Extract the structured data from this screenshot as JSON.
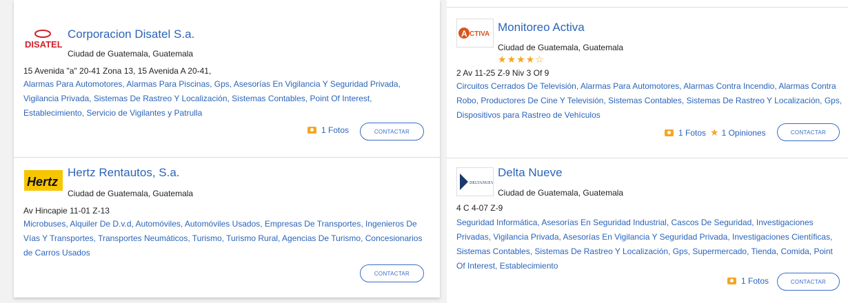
{
  "listings": [
    {
      "name": "Corporacion Disatel S.a.",
      "city": "Ciudad de Guatemala, Guatemala",
      "address": "15 Avenida \"a\" 20-41 Zona 13, 15 Avenida A 20-41,",
      "categories": "Alarmas Para Automotores, Alarmas Para Piscinas, Gps, Asesorías En Vigilancia Y Seguridad Privada, Vigilancia Privada, Sistemas De Rastreo Y Localización, Sistemas Contables, Point Of Interest, Establecimiento, Servicio de Vigilantes y Patrulla",
      "photos": "1 Fotos",
      "button": "CONTACTAR",
      "logo_text": "DISATEL",
      "logo_colors": {
        "text": "#d0202a"
      }
    },
    {
      "name": "Hertz Rentautos, S.a.",
      "city": "Ciudad de Guatemala, Guatemala",
      "address": "Av Hincapie 11-01 Z-13",
      "categories": "Microbuses, Alquiler De D.v.d, Automóviles, Automóviles Usados, Empresas De Transportes, Ingenieros De Vías Y Transportes, Transportes Neumáticos, Turismo, Turismo Rural, Agencias De Turismo, Concesionarios de Carros Usados",
      "button": "CONTACTAR",
      "logo_text": "Hertz",
      "logo_colors": {
        "bg": "#f7c600",
        "text": "#111111"
      }
    },
    {
      "name": "Monitoreo Activa",
      "city": "Ciudad de Guatemala, Guatemala",
      "rating": 4,
      "rating_max": 5,
      "address": "2 Av 11-25 Z-9 Niv 3 Of 9",
      "categories": "Circuitos Cerrados De Televisión, Alarmas Para Automotores, Alarmas Contra Incendio, Alarmas Contra Robo, Productores De Cine Y Televisión, Sistemas Contables, Sistemas De Rastreo Y Localización, Gps, Dispositivos para Rastreo de Vehículos",
      "photos": "1 Fotos",
      "opinions": "1 Opiniones",
      "button": "CONTACTAR",
      "logo_text": "ACTIVA",
      "logo_colors": {
        "text": "#d9541e"
      }
    },
    {
      "name": "Delta Nueve",
      "city": "Ciudad de Guatemala, Guatemala",
      "address": "4 C 4-07 Z-9",
      "categories": "Seguridad Informática, Asesorías En Seguridad Industrial, Cascos De Seguridad, Investigaciones Privadas, Vigilancia Privada, Asesorías En Vigilancia Y Seguridad Privada, Investigaciones Científicas, Sistemas Contables, Sistemas De Rastreo Y Localización, Gps, Supermercado, Tienda, Comida, Point Of Interest, Establecimiento",
      "photos": "1 Fotos",
      "button": "CONTACTAR",
      "logo_text": "DELTANUEVE",
      "logo_colors": {
        "text": "#1a3a6a"
      }
    }
  ],
  "colors": {
    "link": "#2b64b9",
    "accent": "#f5a623"
  }
}
